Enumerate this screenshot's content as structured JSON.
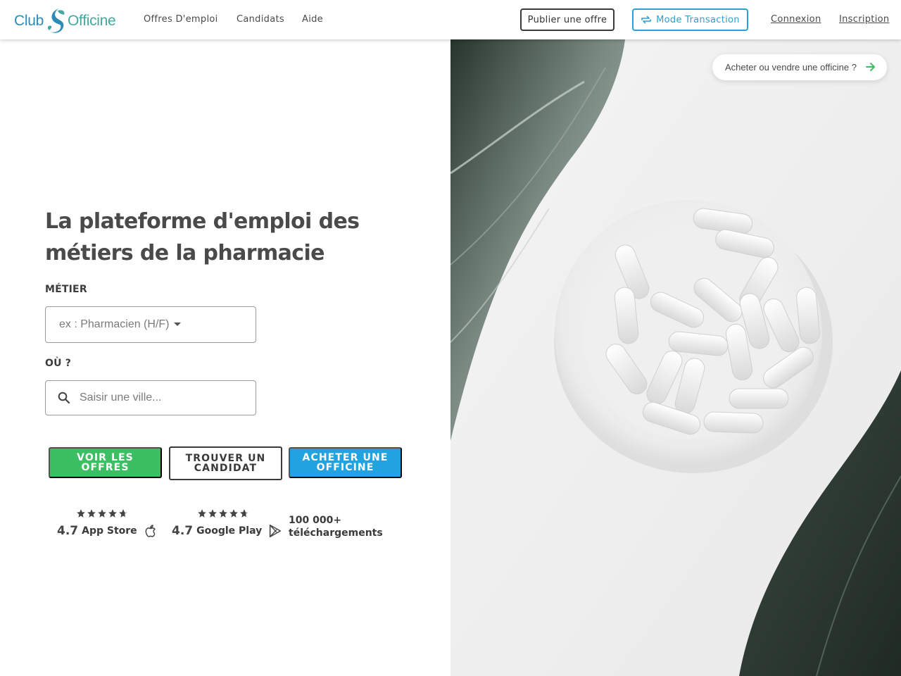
{
  "header": {
    "logo": {
      "part1": "Club",
      "part2": "Officine"
    },
    "nav": [
      {
        "label": "Offres D'emploi"
      },
      {
        "label": "Candidats"
      },
      {
        "label": "Aide"
      }
    ],
    "publish_label": "Publier une offre",
    "transaction_label": "Mode Transaction",
    "login_label": "Connexion",
    "signup_label": "Inscription"
  },
  "hero": {
    "pill_label": "Acheter ou vendre une officine ?",
    "headline": "La plateforme d'emploi des métiers de la pharmacie"
  },
  "search": {
    "job_label": "MÉTIER",
    "job_placeholder": "ex : Pharmacien (H/F)",
    "city_label": "OÙ ?",
    "city_placeholder": "Saisir une ville..."
  },
  "actions": {
    "offers_label": "VOIR LES OFFRES",
    "candidate_label": "TROUVER UN CANDIDAT",
    "buy_label": "ACHETER UNE OFFICINE"
  },
  "ratings": {
    "app_store": {
      "score": "4.7",
      "store": "App Store",
      "stars": 4.7
    },
    "google_play": {
      "score": "4.7",
      "store": "Google Play",
      "stars": 4.7
    },
    "downloads_line1": "100 000+",
    "downloads_line2": "téléchargements"
  },
  "colors": {
    "green": "#3cbf63",
    "blue": "#22a2de",
    "accent_blue": "#2aa0d6",
    "dark": "#3a3a3a",
    "pill_arrow": "#3cbf63"
  }
}
